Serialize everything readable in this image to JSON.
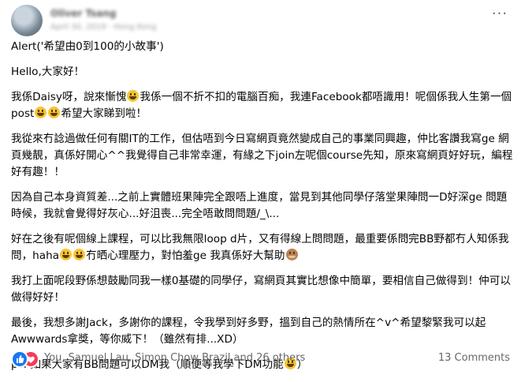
{
  "post": {
    "author": "Oliver Tsang",
    "meta": "April 30, 2019 · Hong Kong",
    "more_label": "···",
    "paragraphs": [
      [
        "Alert('希望由0到100的小故事')"
      ],
      [
        "Hello,大家好！"
      ],
      [
        "我係Daisy呀，說來慚愧",
        {
          "emoji": "grinning-face"
        },
        "我係一個不折不扣的電腦百痴，我連Facebook都唔識用！呢個係我人生第一個post",
        {
          "emoji": "grinning-face"
        },
        {
          "emoji": "grinning-face"
        },
        "希望大家睇到啦！"
      ],
      [
        "我從來冇諗過做任何有關IT的工作，但估唔到今日寫網頁竟然變成自己的事業同興趣，仲比客讚我寫ge 網頁幾靚，真係好開心^^我覺得自己非常幸運，有緣之下join左呢個course先知，原來寫網頁好好玩，編程好有趣！！"
      ],
      [
        "因為自己本身資質差...之前上實體班果陣完全跟唔上進度，當見到其他同學仔落堂果陣問一D好深ge 問題時候，我就會覺得好灰心...好沮喪...完全唔敢問問題/_\\..."
      ],
      [
        "好在之後有呢個線上課程，可以比我無限loop d片，又有得線上問問題，最重要係問完BB野都冇人知係我問，haha",
        {
          "emoji": "grinning-face"
        },
        {
          "emoji": "grinning-face"
        },
        "冇晒心理壓力，對怕羞ge 我真係好大幫助",
        {
          "emoji": "see-no-evil-monkey"
        }
      ],
      [
        "我打上面呢段野係想鼓勵同我一樣0基礎的同學仔，寫網頁其實比想像中簡單，要相信自己做得到！仲可以做得好好！"
      ],
      [
        "最後，我想多謝Jack，多謝你的課程，令我學到好多野，搵到自己的熱情所在^v^希望黎緊我可以起Awwwards拿獎，等你威下！（雖然有排...XD）"
      ],
      [
        "ps. 如果大家有BB問題可以DM我（順便等我學下DM功能",
        {
          "emoji": "grinning-face"
        },
        "）"
      ]
    ]
  },
  "footer": {
    "reaction_icons": [
      "like-icon",
      "love-icon"
    ],
    "reactors": "You, Samuel Lau, Simon Chow Brazil and 26 others",
    "comments": "13 Comments"
  },
  "colors": {
    "like": "#1877f2",
    "love": "#f33e58",
    "secondary_text": "#65676b"
  }
}
